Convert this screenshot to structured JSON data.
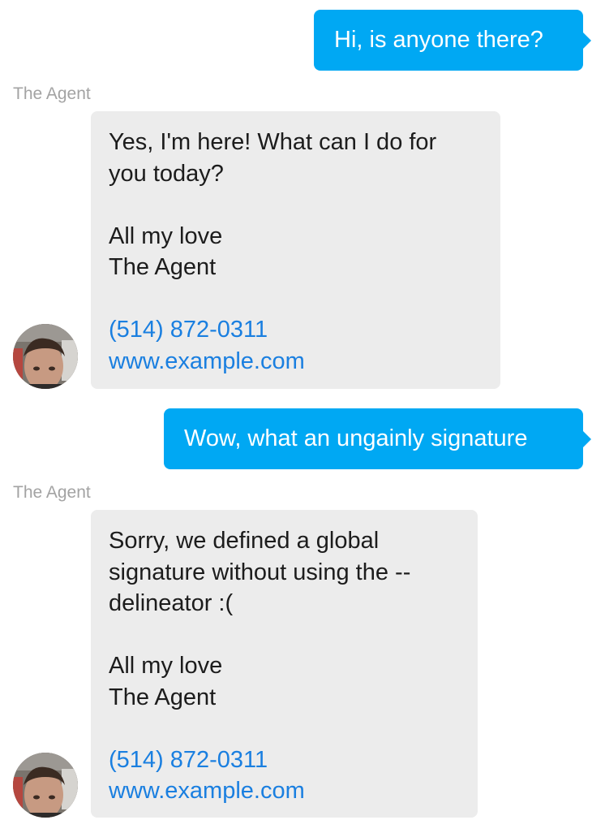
{
  "messages": [
    {
      "direction": "outgoing",
      "text": "Hi, is anyone there?"
    },
    {
      "direction": "incoming",
      "sender": "The Agent",
      "body_lines": [
        "Yes, I'm here! What can I do for",
        "you today?"
      ],
      "signature": {
        "closing": "All my love",
        "name": "The Agent",
        "phone": "(514) 872-0311",
        "website": "www.example.com"
      }
    },
    {
      "direction": "outgoing",
      "text": "Wow, what an ungainly signature"
    },
    {
      "direction": "incoming",
      "sender": "The Agent",
      "body_lines": [
        "Sorry, we defined a global",
        "signature without using the --",
        "delineator :("
      ],
      "signature": {
        "closing": "All my love",
        "name": "The Agent",
        "phone": "(514) 872-0311",
        "website": "www.example.com"
      }
    }
  ],
  "colors": {
    "outgoing_bubble": "#00a8f3",
    "incoming_bubble": "#ececec",
    "link": "#1a7fe0",
    "sender_label": "#a3a3a3"
  },
  "icons": {
    "avatar": "agent-avatar-photo"
  }
}
